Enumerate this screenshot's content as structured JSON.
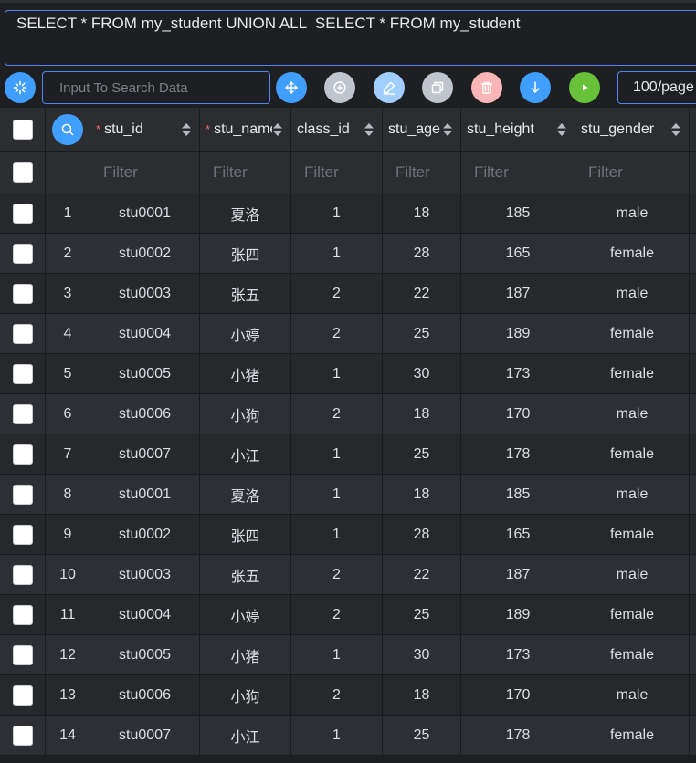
{
  "sql": {
    "query": "SELECT * FROM my_student UNION ALL  SELECT * FROM my_student"
  },
  "toolbar": {
    "search_placeholder": "Input To Search Data",
    "page_size": "100/page",
    "buttons": [
      {
        "name": "refresh-icon",
        "color": "#409eff"
      },
      {
        "name": "move-icon",
        "color": "#409eff"
      },
      {
        "name": "add-icon",
        "color": "#c0c4cc"
      },
      {
        "name": "edit-icon",
        "color": "#a0cfff"
      },
      {
        "name": "copy-icon",
        "color": "#c0c4cc"
      },
      {
        "name": "delete-icon",
        "color": "#fab6b6"
      },
      {
        "name": "download-icon",
        "color": "#409eff"
      },
      {
        "name": "run-icon",
        "color": "#67c23a"
      }
    ]
  },
  "table": {
    "columns": [
      {
        "key": "stu_id",
        "label": "stu_id",
        "required": true
      },
      {
        "key": "stu_name",
        "label": "stu_name",
        "required": true
      },
      {
        "key": "class_id",
        "label": "class_id",
        "required": false
      },
      {
        "key": "stu_age",
        "label": "stu_age",
        "required": false
      },
      {
        "key": "stu_height",
        "label": "stu_height",
        "required": false
      },
      {
        "key": "stu_gender",
        "label": "stu_gender",
        "required": false
      }
    ],
    "filter_placeholder": "Filter",
    "rows": [
      {
        "index": "1",
        "stu_id": "stu0001",
        "stu_name": "夏洛",
        "class_id": "1",
        "stu_age": "18",
        "stu_height": "185",
        "stu_gender": "male"
      },
      {
        "index": "2",
        "stu_id": "stu0002",
        "stu_name": "张四",
        "class_id": "1",
        "stu_age": "28",
        "stu_height": "165",
        "stu_gender": "female"
      },
      {
        "index": "3",
        "stu_id": "stu0003",
        "stu_name": "张五",
        "class_id": "2",
        "stu_age": "22",
        "stu_height": "187",
        "stu_gender": "male"
      },
      {
        "index": "4",
        "stu_id": "stu0004",
        "stu_name": "小婷",
        "class_id": "2",
        "stu_age": "25",
        "stu_height": "189",
        "stu_gender": "female"
      },
      {
        "index": "5",
        "stu_id": "stu0005",
        "stu_name": "小猪",
        "class_id": "1",
        "stu_age": "30",
        "stu_height": "173",
        "stu_gender": "female"
      },
      {
        "index": "6",
        "stu_id": "stu0006",
        "stu_name": "小狗",
        "class_id": "2",
        "stu_age": "18",
        "stu_height": "170",
        "stu_gender": "male"
      },
      {
        "index": "7",
        "stu_id": "stu0007",
        "stu_name": "小江",
        "class_id": "1",
        "stu_age": "25",
        "stu_height": "178",
        "stu_gender": "female"
      },
      {
        "index": "8",
        "stu_id": "stu0001",
        "stu_name": "夏洛",
        "class_id": "1",
        "stu_age": "18",
        "stu_height": "185",
        "stu_gender": "male"
      },
      {
        "index": "9",
        "stu_id": "stu0002",
        "stu_name": "张四",
        "class_id": "1",
        "stu_age": "28",
        "stu_height": "165",
        "stu_gender": "female"
      },
      {
        "index": "10",
        "stu_id": "stu0003",
        "stu_name": "张五",
        "class_id": "2",
        "stu_age": "22",
        "stu_height": "187",
        "stu_gender": "male"
      },
      {
        "index": "11",
        "stu_id": "stu0004",
        "stu_name": "小婷",
        "class_id": "2",
        "stu_age": "25",
        "stu_height": "189",
        "stu_gender": "female"
      },
      {
        "index": "12",
        "stu_id": "stu0005",
        "stu_name": "小猪",
        "class_id": "1",
        "stu_age": "30",
        "stu_height": "173",
        "stu_gender": "female"
      },
      {
        "index": "13",
        "stu_id": "stu0006",
        "stu_name": "小狗",
        "class_id": "2",
        "stu_age": "18",
        "stu_height": "170",
        "stu_gender": "male"
      },
      {
        "index": "14",
        "stu_id": "stu0007",
        "stu_name": "小江",
        "class_id": "1",
        "stu_age": "25",
        "stu_height": "178",
        "stu_gender": "female"
      }
    ]
  }
}
